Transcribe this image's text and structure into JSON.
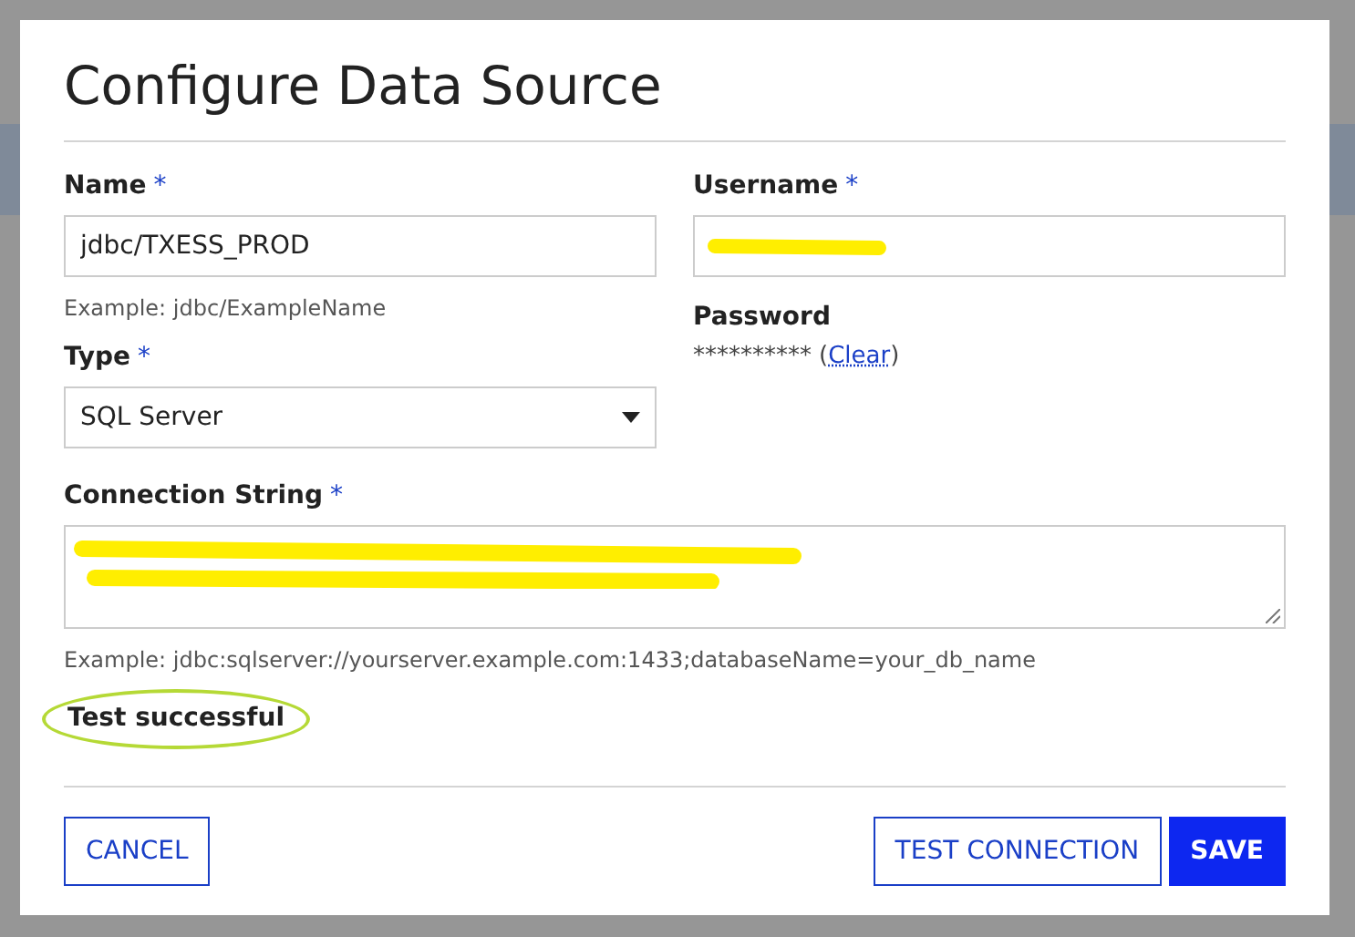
{
  "dialog": {
    "title": "Configure Data Source",
    "name_field": {
      "label": "Name",
      "required": "*",
      "value": "jdbc/TXESS_PROD",
      "hint": "Example: jdbc/ExampleName"
    },
    "username_field": {
      "label": "Username",
      "required": "*",
      "redacted": true
    },
    "password": {
      "label": "Password",
      "value": "**********",
      "link_open": "(",
      "link": "Clear",
      "link_close": ")"
    },
    "type_field": {
      "label": "Type",
      "required": "*",
      "value": "SQL Server"
    },
    "connection_field": {
      "label": "Connection String",
      "required": "*",
      "redacted": true,
      "hint": "Example: jdbc:sqlserver://yourserver.example.com:1433;databaseName=your_db_name"
    },
    "status": {
      "text": "Test successful",
      "circled": true
    },
    "buttons": [
      {
        "label": "CANCEL",
        "kind": "outline"
      },
      {
        "label": "TEST CONNECTION",
        "kind": "outline"
      },
      {
        "label": "SAVE",
        "kind": "primary"
      }
    ]
  }
}
